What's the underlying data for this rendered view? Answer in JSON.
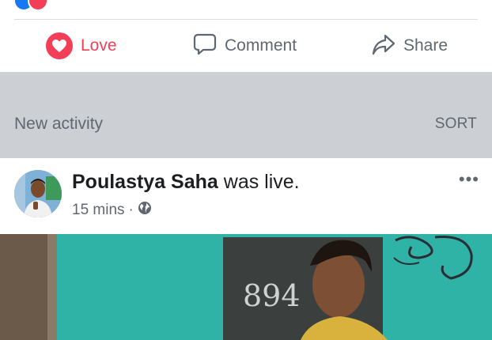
{
  "actions": {
    "love_label": "Love",
    "comment_label": "Comment",
    "share_label": "Share"
  },
  "activity": {
    "title": "New activity",
    "sort_label": "SORT"
  },
  "post": {
    "author": "Poulastya Saha",
    "action_text": " was live.",
    "time": "15 mins",
    "separator": "·",
    "privacy_icon": "globe-icon",
    "more_label": "•••",
    "video_wall_text": "894"
  },
  "colors": {
    "love": "#f33e58",
    "gray_text": "#606770",
    "band": "#ccd0d5",
    "video_teal": "#2fb3a6"
  }
}
